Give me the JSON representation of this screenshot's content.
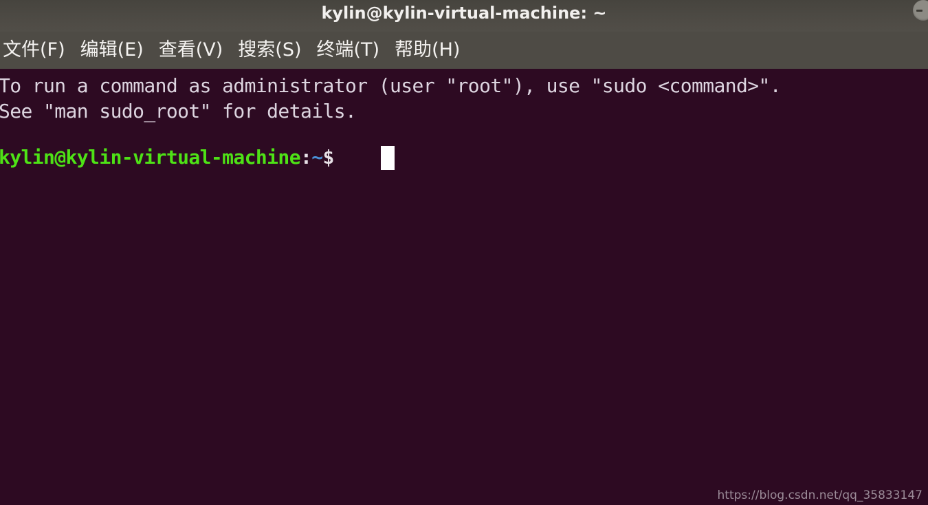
{
  "window": {
    "title": "kylin@kylin-virtual-machine: ~",
    "minimize_icon": "minimize-icon",
    "titlebar_color": "#4d4a44",
    "menubar_color": "#4e4b45",
    "terminal_bg_color": "#2d0a22"
  },
  "menubar": {
    "items": [
      {
        "label": "文件(F)"
      },
      {
        "label": "编辑(E)"
      },
      {
        "label": "查看(V)"
      },
      {
        "label": "搜索(S)"
      },
      {
        "label": "终端(T)"
      },
      {
        "label": "帮助(H)"
      }
    ]
  },
  "terminal": {
    "lines": [
      "To run a command as administrator (user \"root\"), use \"sudo <command>\".",
      "See \"man sudo_root\" for details."
    ],
    "prompt": {
      "user_host": "kylin@kylin-virtual-machine",
      "separator": ":",
      "path": "~",
      "sigil": "$",
      "command": "",
      "user_host_color": "#4ee216",
      "path_color": "#4a8fd6",
      "cursor_color": "#ffffff"
    }
  },
  "watermark": {
    "text": "https://blog.csdn.net/qq_35833147"
  }
}
